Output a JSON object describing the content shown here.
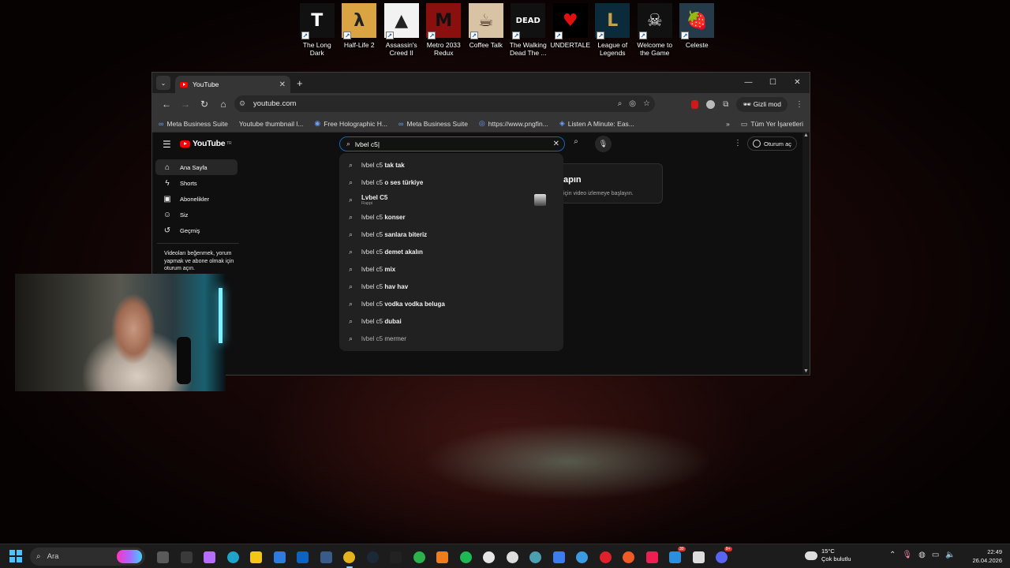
{
  "desktop_icons": [
    {
      "label": "The Long Dark",
      "art": "T",
      "bg": "#111111",
      "fg": "#ffffff"
    },
    {
      "label": "Half-Life 2",
      "art": "λ",
      "bg": "#d9a441",
      "fg": "#222222"
    },
    {
      "label": "Assassin's Creed II",
      "art": "▲",
      "bg": "#f2f2f2",
      "fg": "#222222"
    },
    {
      "label": "Metro 2033 Redux",
      "art": "M",
      "bg": "#8a0f0f",
      "fg": "#111111"
    },
    {
      "label": "Coffee Talk",
      "art": "☕",
      "bg": "#d8c3a5",
      "fg": "#3a2418"
    },
    {
      "label": "The Walking Dead The ...",
      "art": "DEAD",
      "bg": "#111111",
      "fg": "#ffffff"
    },
    {
      "label": "UNDERTALE",
      "art": "♥",
      "bg": "#000000",
      "fg": "#e01010"
    },
    {
      "label": "League of Legends",
      "art": "L",
      "bg": "#0c2b3a",
      "fg": "#c8a24a"
    },
    {
      "label": "Welcome to the Game",
      "art": "☠",
      "bg": "#111111",
      "fg": "#f0f0f0"
    },
    {
      "label": "Celeste",
      "art": "🍓",
      "bg": "#263b4a",
      "fg": "#d8324a"
    }
  ],
  "browser": {
    "tab": {
      "title": "YouTube"
    },
    "address": "youtube.com",
    "incognito_label": "Gizli mod",
    "bookmarks": [
      {
        "label": "Meta Business Suite",
        "icon": "∞"
      },
      {
        "label": "Youtube thumbnail l...",
        "icon": ""
      },
      {
        "label": "Free Holographic H...",
        "icon": "◉"
      },
      {
        "label": "Meta Business Suite",
        "icon": "∞"
      },
      {
        "label": "https://www.pngfin...",
        "icon": "◎"
      },
      {
        "label": "Listen A Minute: Eas...",
        "icon": "◈"
      }
    ],
    "all_bookmarks": "Tüm Yer İşaretleri"
  },
  "youtube": {
    "region": "TR",
    "logo_text": "YouTube",
    "search_value": "lvbel c5",
    "signin_label": "Oturum aç",
    "sidebar": [
      {
        "label": "Ana Sayfa",
        "icon": "⌂",
        "active": true
      },
      {
        "label": "Shorts",
        "icon": "ϟ",
        "active": false
      },
      {
        "label": "Abonelikler",
        "icon": "▣",
        "active": false
      },
      {
        "label": "Siz",
        "icon": "☺",
        "active": false
      },
      {
        "label": "Geçmiş",
        "icon": "↺",
        "active": false
      }
    ],
    "sidebar_note": "Videoları beğenmek, yorum yapmak ve abone olmak için oturum açın.",
    "card": {
      "heading": "apın",
      "text": "için video izlemeye başlayın."
    },
    "suggestions": [
      {
        "prefix": "lvbel c5 ",
        "bold": "tak tak"
      },
      {
        "prefix": "lvbel c5 ",
        "bold": "o ses türkiye"
      },
      {
        "prefix": "",
        "bold": "Lvbel C5",
        "sub": "Rappi",
        "thumb": true
      },
      {
        "prefix": "lvbel c5 ",
        "bold": "konser"
      },
      {
        "prefix": "lvbel c5 ",
        "bold": "sanlara biteriz"
      },
      {
        "prefix": "lvbel c5 ",
        "bold": "demet akalın"
      },
      {
        "prefix": "lvbel c5 ",
        "bold": "mix"
      },
      {
        "prefix": "lvbel c5 ",
        "bold": "hav hav"
      },
      {
        "prefix": "lvbel c5 ",
        "bold": "vodka vodka beluga"
      },
      {
        "prefix": "lvbel c5 ",
        "bold": "dubai"
      },
      {
        "prefix": "lvbel c5 ",
        "bold": "mermer",
        "faint": true
      }
    ]
  },
  "taskbar": {
    "search_placeholder": "Ara",
    "apps": [
      {
        "name": "file-explorer-icon",
        "color": "#5a5a5a"
      },
      {
        "name": "monitor-icon",
        "color": "#3a3a3a"
      },
      {
        "name": "copilot-icon",
        "color": "#b86bff"
      },
      {
        "name": "edge-icon",
        "color": "#1fa3c9"
      },
      {
        "name": "folder-icon",
        "color": "#f5c518"
      },
      {
        "name": "store-icon",
        "color": "#2d7de0"
      },
      {
        "name": "outlook-icon",
        "color": "#0b63c5"
      },
      {
        "name": "calculator-icon",
        "color": "#3a5a8a"
      },
      {
        "name": "chrome-icon",
        "color": "#e4b21a",
        "active": true
      },
      {
        "name": "steam-icon",
        "color": "#1b2838"
      },
      {
        "name": "epic-games-icon",
        "color": "#222222"
      },
      {
        "name": "xbox-icon",
        "color": "#2cb24a"
      },
      {
        "name": "sublime-icon",
        "color": "#f07d1a"
      },
      {
        "name": "spotify-icon",
        "color": "#1db954"
      },
      {
        "name": "obs-icon",
        "color": "#e5e5e5"
      },
      {
        "name": "settings-icon",
        "color": "#dddddd"
      },
      {
        "name": "maps-icon",
        "color": "#4aa0b0"
      },
      {
        "name": "todo-icon",
        "color": "#3b7cf0"
      },
      {
        "name": "teams-icon",
        "color": "#3a9be0"
      },
      {
        "name": "opera-icon",
        "color": "#e0202a"
      },
      {
        "name": "brave-icon",
        "color": "#f05a24"
      },
      {
        "name": "tiktok-icon",
        "color": "#ee1d52"
      },
      {
        "name": "whatsapp-icon",
        "color": "#2a8fe0",
        "badge": "30"
      },
      {
        "name": "capcut-icon",
        "color": "#dddddd"
      },
      {
        "name": "discord-icon",
        "color": "#5865f2",
        "badge": "9+"
      }
    ],
    "weather": {
      "temp": "15°C",
      "desc": "Çok bulutlu"
    },
    "time": "22:49",
    "date": "26.04.2026"
  }
}
